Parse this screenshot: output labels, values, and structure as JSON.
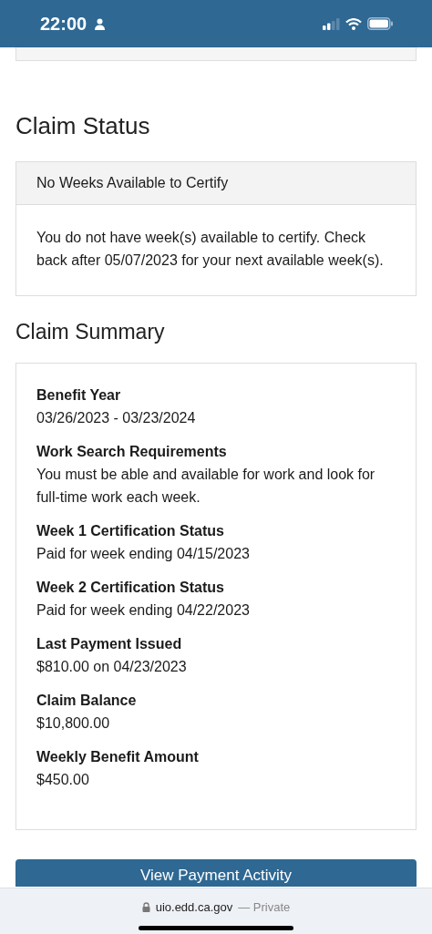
{
  "status_bar": {
    "time": "22:00"
  },
  "claim_status": {
    "title": "Claim Status",
    "card_header": "No Weeks Available to Certify",
    "message": "You do not have week(s) available to certify. Check back after 05/07/2023 for your next available week(s)."
  },
  "claim_summary": {
    "title": "Claim Summary",
    "items": [
      {
        "label": "Benefit Year",
        "value": "03/26/2023 - 03/23/2024"
      },
      {
        "label": "Work Search Requirements",
        "value": "You must be able and available for work and look for full-time work each week."
      },
      {
        "label": "Week 1 Certification Status",
        "value": "Paid for week ending 04/15/2023"
      },
      {
        "label": "Week 2 Certification Status",
        "value": "Paid for week ending 04/22/2023"
      },
      {
        "label": "Last Payment Issued",
        "value": "$810.00 on 04/23/2023"
      },
      {
        "label": "Claim Balance",
        "value": "$10,800.00"
      },
      {
        "label": "Weekly Benefit Amount",
        "value": "$450.00"
      }
    ]
  },
  "button": "View Payment Activity",
  "address_bar": {
    "domain": "uio.edd.ca.gov",
    "mode": "— Private"
  }
}
